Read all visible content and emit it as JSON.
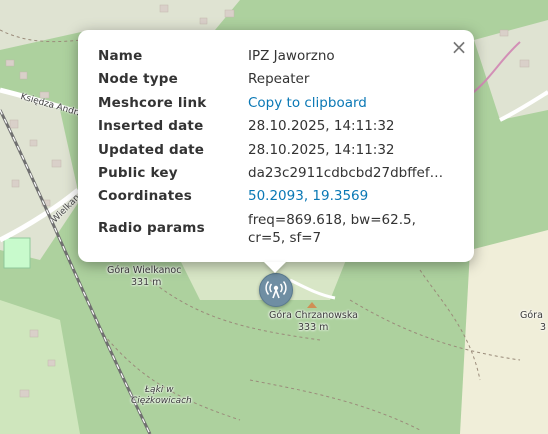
{
  "popup": {
    "close_label": "×",
    "fields": {
      "name": {
        "label": "Name",
        "value": "IPZ Jaworzno"
      },
      "node_type": {
        "label": "Node type",
        "value": "Repeater"
      },
      "meshcore_link": {
        "label": "Meshcore link",
        "value": "Copy to clipboard"
      },
      "inserted_date": {
        "label": "Inserted date",
        "value": "28.10.2025, 14:11:32"
      },
      "updated_date": {
        "label": "Updated date",
        "value": "28.10.2025, 14:11:32"
      },
      "public_key": {
        "label": "Public key",
        "value": "da23c2911cdbcbd27dbffef7…"
      },
      "coordinates": {
        "label": "Coordinates",
        "value": "50.2093, 19.3569"
      },
      "radio_params": {
        "label": "Radio params",
        "value": "freq=869.618, bw=62.5, cr=5, sf=7"
      }
    }
  },
  "map": {
    "labels": {
      "gora_wielkanoc_name": "Góra Wielkanoc",
      "gora_wielkanoc_elev": "331 m",
      "gora_chrzanowska_name": "Góra Chrzanowska",
      "gora_chrzanowska_elev": "333 m",
      "laki_line1": "Łąki w",
      "laki_line2": "Ciężkowicach",
      "gora_edge_name": "Góra",
      "gora_edge_elev": "3",
      "road_ksiedza": "Księdza Andrz",
      "road_wielkan": "Wielkan"
    },
    "marker_icon": "radio-tower-icon",
    "colors": {
      "forest": "#add19e",
      "residential": "#e0dfdf",
      "park": "#c8facc",
      "link": "#0a78b5",
      "marker": "#6f8ea3"
    }
  }
}
